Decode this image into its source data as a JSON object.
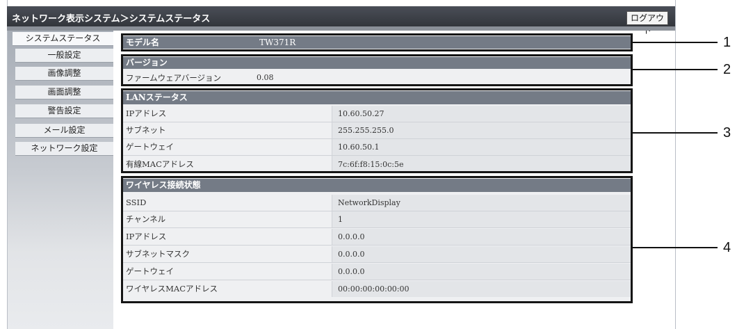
{
  "header": {
    "breadcrumb": "ネットワーク表示システム＞システムステータス",
    "logout_label": "ログアウト"
  },
  "sidebar": {
    "items": [
      {
        "label": "システムステータス",
        "active": true
      },
      {
        "label": "一般設定"
      },
      {
        "label": "画像調整"
      },
      {
        "label": "画面調整"
      },
      {
        "label": "警告設定"
      },
      {
        "label": "メール設定"
      },
      {
        "label": "ネットワーク設定"
      }
    ]
  },
  "model": {
    "label": "モデル名",
    "value": "TW371R"
  },
  "version": {
    "title": "バージョン",
    "label": "ファームウェアバージョン",
    "value": "0.08"
  },
  "lan": {
    "title": "LANステータス",
    "rows": [
      {
        "label": "IPアドレス",
        "value": "10.60.50.27"
      },
      {
        "label": "サブネット",
        "value": "255.255.255.0"
      },
      {
        "label": "ゲートウェイ",
        "value": "10.60.50.1"
      },
      {
        "label": "有線MACアドレス",
        "value": "7c:6f:f8:15:0c:5e"
      }
    ]
  },
  "wireless": {
    "title": "ワイヤレス接続状態",
    "rows": [
      {
        "label": "SSID",
        "value": "NetworkDisplay"
      },
      {
        "label": "チャンネル",
        "value": "1"
      },
      {
        "label": "IPアドレス",
        "value": "0.0.0.0"
      },
      {
        "label": "サブネットマスク",
        "value": "0.0.0.0"
      },
      {
        "label": "ゲートウェイ",
        "value": "0.0.0.0"
      },
      {
        "label": "ワイヤレスMACアドレス",
        "value": "00:00:00:00:00:00"
      }
    ]
  },
  "callouts": [
    "1",
    "2",
    "3",
    "4"
  ]
}
